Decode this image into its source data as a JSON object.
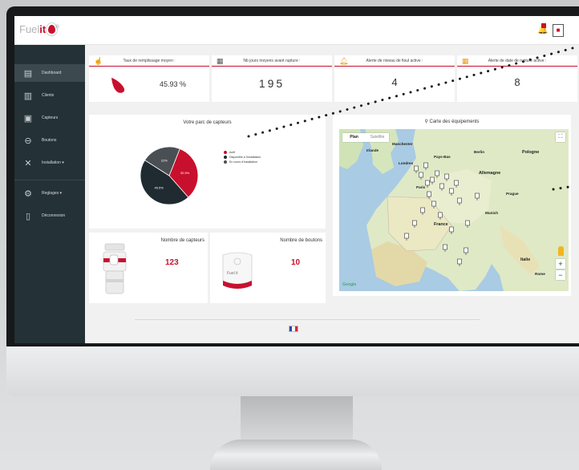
{
  "app": {
    "logo_fuel": "Fuel",
    "logo_it": "it",
    "logo_mark": "®"
  },
  "topbar": {
    "bell_icon": "bell-icon",
    "user_icon": "user-icon"
  },
  "sidebar": {
    "items": [
      {
        "label": "Dashboard",
        "icon": "dashboard-icon",
        "active": true
      },
      {
        "label": "Clients",
        "icon": "buildings-icon",
        "active": false
      },
      {
        "label": "Capteurs",
        "icon": "sensor-icon",
        "active": false
      },
      {
        "label": "Boutons",
        "icon": "button-icon",
        "active": false
      },
      {
        "label": "Installation ▾",
        "icon": "tools-icon",
        "active": false
      },
      {
        "label": "Reglages ▾",
        "icon": "gear-icon",
        "active": false
      },
      {
        "label": "Déconnexion",
        "icon": "logout-door-icon",
        "active": false
      }
    ]
  },
  "kpis": [
    {
      "title": "Taux de remplissage moyen :",
      "value": "45.93 %",
      "icon": "fuel-hand-icon"
    },
    {
      "title": "Nb jours moyens avant rupture :",
      "value": "195",
      "icon": "calendar-icon"
    },
    {
      "title": "Alerte de niveau de fioul active :",
      "value": "4",
      "icon": "bell-icon"
    },
    {
      "title": "Alerte de date de rupture active :",
      "value": "8",
      "icon": "calendar-alert-icon"
    }
  ],
  "pie_card": {
    "title": "Votre parc de capteurs",
    "legend": [
      {
        "label": "Actif",
        "color": "#c8102e"
      },
      {
        "label": "Disponible à l'installation",
        "color": "#1f2b30"
      },
      {
        "label": "En cours d'installation",
        "color": "#4a4f53"
      }
    ]
  },
  "chart_data": {
    "type": "pie",
    "title": "Votre parc de capteurs",
    "slices": [
      {
        "label": "Actif",
        "value": 32.5,
        "text": "32.5%",
        "color": "#c8102e"
      },
      {
        "label": "Disponible à l'installation",
        "value": 45.5,
        "text": "45.5%",
        "color": "#1f2b30"
      },
      {
        "label": "En cours d'installation",
        "value": 22.0,
        "text": "22%",
        "color": "#4a4f53"
      }
    ]
  },
  "map_card": {
    "title": "Carte des équipements",
    "map_icon": "map-pin-icon",
    "tab_plan": "Plan",
    "tab_satellite": "Satellite",
    "zoom_in": "+",
    "zoom_out": "−",
    "fullscreen": "⛶",
    "google": "Google",
    "labels": [
      {
        "text": "Irlande",
        "id": "ireland"
      },
      {
        "text": "Allemagne",
        "id": "germany"
      },
      {
        "text": "Pologne",
        "id": "poland"
      },
      {
        "text": "France",
        "id": "france"
      },
      {
        "text": "Italie",
        "id": "italy"
      },
      {
        "text": "Manchester",
        "id": "manchester"
      },
      {
        "text": "Londres",
        "id": "london"
      },
      {
        "text": "Pays-Bas",
        "id": "netherlands"
      },
      {
        "text": "Paris",
        "id": "paris"
      },
      {
        "text": "Prague",
        "id": "prague"
      },
      {
        "text": "Munich",
        "id": "munich"
      },
      {
        "text": "Rome",
        "id": "rome"
      },
      {
        "text": "Berlin",
        "id": "berlin"
      }
    ]
  },
  "capteurs_card": {
    "title": "Nombre de capteurs",
    "value": "123"
  },
  "boutons_card": {
    "title": "Nombre de boutons",
    "value": "10",
    "device_text": "Fuel it"
  },
  "footer": {
    "flag": "french-flag-icon"
  }
}
